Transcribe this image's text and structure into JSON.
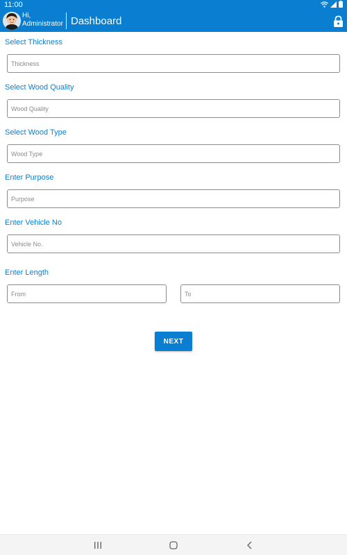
{
  "status_bar": {
    "time": "11:00"
  },
  "app_bar": {
    "greeting_line1": "Hi,",
    "greeting_line2": "Administrator",
    "title": "Dashboard"
  },
  "form": {
    "thickness": {
      "label": "Select Thickness",
      "placeholder": "Thickness"
    },
    "wood_quality": {
      "label": "Select Wood Quality",
      "placeholder": "Wood Quality"
    },
    "wood_type": {
      "label": "Select Wood Type",
      "placeholder": "Wood Type"
    },
    "purpose": {
      "label": "Enter Purpose",
      "placeholder": "Purpose"
    },
    "vehicle_no": {
      "label": "Enter Vehicle No",
      "placeholder": "Vehicle No."
    },
    "length": {
      "label": "Enter Length",
      "from_placeholder": "From",
      "to_placeholder": "To"
    },
    "next_label": "NEXT"
  },
  "colors": {
    "primary": "#0a7fd2",
    "label": "#0a7fd2",
    "border": "#8c8c8c"
  },
  "icons": {
    "status": [
      "wifi-icon",
      "signal-icon",
      "battery-icon"
    ],
    "app_bar": [
      "avatar",
      "lock-icon"
    ],
    "nav": [
      "recent-apps-icon",
      "home-icon",
      "back-icon"
    ]
  }
}
